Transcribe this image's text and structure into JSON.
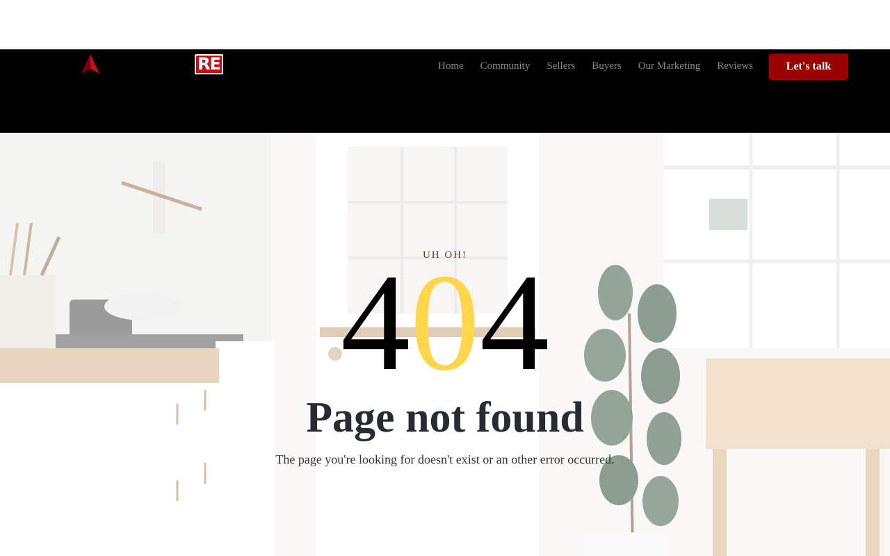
{
  "brand": {
    "logo_badge": "RE",
    "mark_color": "#c0101a"
  },
  "nav": {
    "items": [
      {
        "label": "Home"
      },
      {
        "label": "Community"
      },
      {
        "label": "Sellers"
      },
      {
        "label": "Buyers"
      },
      {
        "label": "Our Marketing"
      },
      {
        "label": "Reviews"
      }
    ],
    "cta_label": "Let's talk"
  },
  "error": {
    "eyebrow": "UH OH!",
    "code_first": "4",
    "code_middle": "0",
    "code_last": "4",
    "title": "Page not found",
    "message": "The page you're looking for doesn't exist or an other error occurred."
  },
  "colors": {
    "navbar_bg": "#000000",
    "cta_bg": "#9b0000",
    "accent_zero": "#ffd54a",
    "headline": "#262c33"
  }
}
